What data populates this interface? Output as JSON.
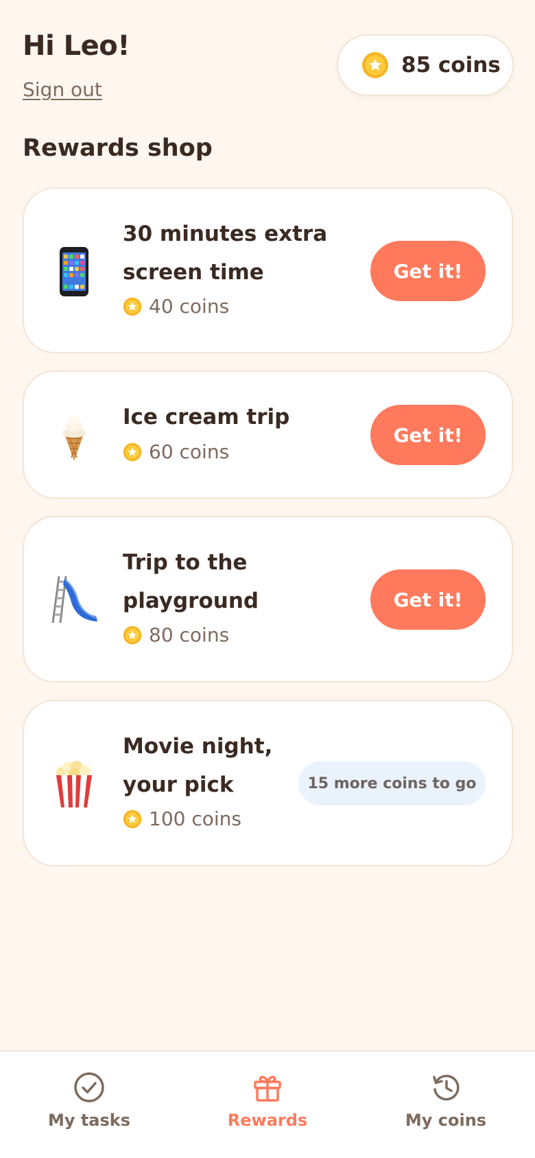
{
  "header": {
    "greeting": "Hi Leo!",
    "signout_label": "Sign out",
    "balance": "85 coins"
  },
  "section_title": "Rewards shop",
  "rewards": [
    {
      "icon": "mobile-phone-icon",
      "title": "30 minutes extra screen time",
      "cost": "40 coins",
      "action": "Get it!"
    },
    {
      "icon": "ice-cream-icon",
      "title": "Ice cream trip",
      "cost": "60 coins",
      "action": "Get it!"
    },
    {
      "icon": "slide-icon",
      "title": "Trip to the playground",
      "cost": "80 coins",
      "action": "Get it!"
    },
    {
      "icon": "popcorn-icon",
      "title": "Movie night, your pick",
      "cost": "100 coins",
      "status": "15 more coins to go"
    }
  ],
  "nav": [
    {
      "label": "My tasks",
      "icon": "check-circle-icon",
      "active": false
    },
    {
      "label": "Rewards",
      "icon": "gift-icon",
      "active": true
    },
    {
      "label": "My coins",
      "icon": "history-icon",
      "active": false
    }
  ],
  "colors": {
    "background": "#FEF6EF",
    "accent": "#FF7A5C",
    "coin": "#F8C232",
    "text": "#3A2A22",
    "muted": "#7E6A5E",
    "badge": "#EAF2FC"
  }
}
